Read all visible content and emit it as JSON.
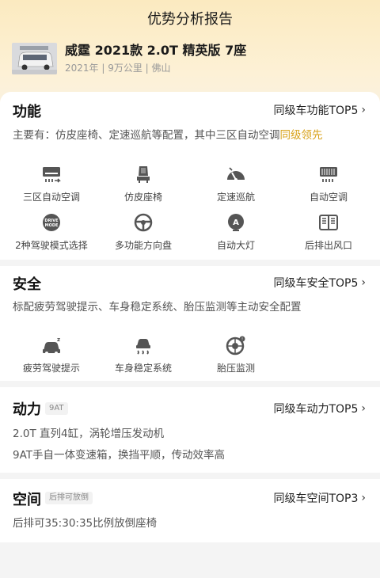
{
  "page": {
    "title": "优势分析报告"
  },
  "car": {
    "name": "威霆 2021款 2.0T 精英版 7座",
    "meta": "2021年 | 9万公里 | 佛山",
    "thumb_text": ""
  },
  "sections": {
    "function": {
      "title": "功能",
      "rank": "同级车功能TOP5",
      "desc_main": "主要有：仿皮座椅、定速巡航等配置，其中三区自动空调",
      "desc_highlight": "同级领先",
      "features": [
        {
          "label": "三区自动空调",
          "icon": "ac-zone-icon"
        },
        {
          "label": "仿皮座椅",
          "icon": "leather-seat-icon"
        },
        {
          "label": "定速巡航",
          "icon": "cruise-control-icon"
        },
        {
          "label": "自动空调",
          "icon": "auto-ac-icon"
        },
        {
          "label": "2种驾驶模式选择",
          "icon": "drive-mode-icon"
        },
        {
          "label": "多功能方向盘",
          "icon": "steering-wheel-icon"
        },
        {
          "label": "自动大灯",
          "icon": "auto-headlight-icon"
        },
        {
          "label": "后排出风口",
          "icon": "rear-vent-icon"
        }
      ]
    },
    "safety": {
      "title": "安全",
      "rank": "同级车安全TOP5",
      "desc": "标配疲劳驾驶提示、车身稳定系统、胎压监测等主动安全配置",
      "features": [
        {
          "label": "疲劳驾驶提示",
          "icon": "fatigue-alert-icon"
        },
        {
          "label": "车身稳定系统",
          "icon": "stability-control-icon"
        },
        {
          "label": "胎压监测",
          "icon": "tire-pressure-icon"
        }
      ]
    },
    "power": {
      "title": "动力",
      "tag": "9AT",
      "rank": "同级车动力TOP5",
      "lines": [
        "2.0T 直列4缸，涡轮增压发动机",
        "9AT手自一体变速箱，换挡平顺，传动效率高"
      ]
    },
    "space": {
      "title": "空间",
      "tag": "后排可放倒",
      "rank": "同级车空间TOP3",
      "desc": "后排可35:30:35比例放倒座椅"
    }
  },
  "chevron": "›"
}
